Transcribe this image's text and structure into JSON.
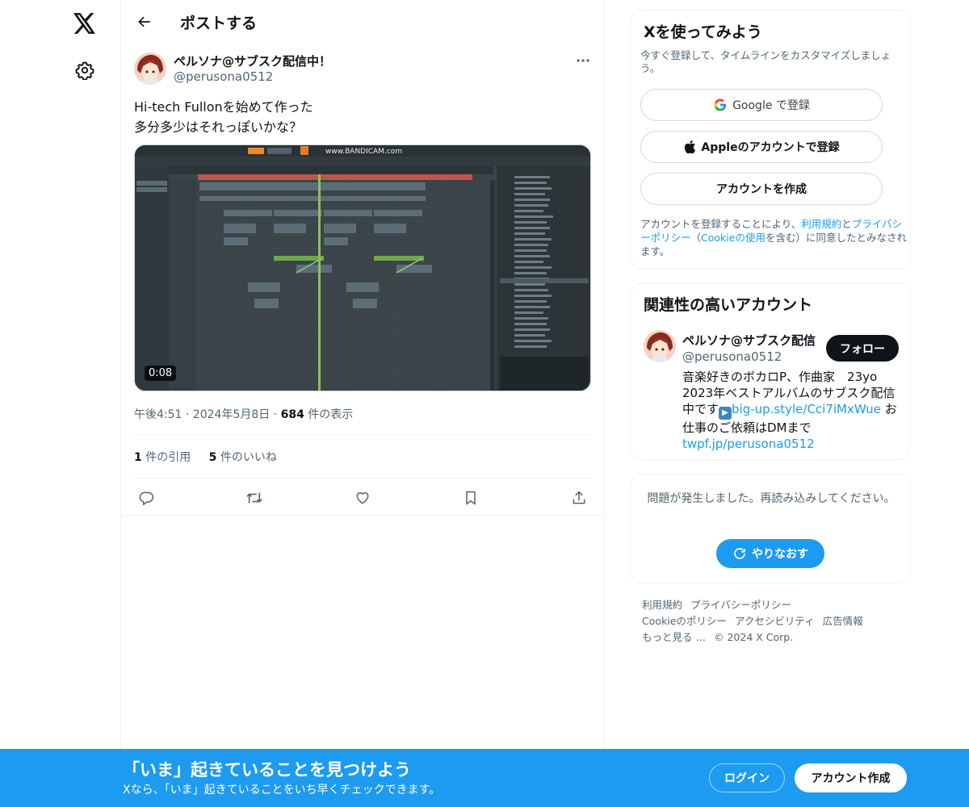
{
  "nav": {
    "logo_icon": "x-logo-icon",
    "settings_icon": "gear-icon"
  },
  "header": {
    "title": "ポストする",
    "back_icon": "arrow-left-icon"
  },
  "tweet": {
    "author_name": "ペルソナ@サブスク配信中！",
    "author_handle": "@perusona0512",
    "text_line1": "Hi-tech Fullonを始めて作った",
    "text_line2": "多分多少はそれっぽいかな？",
    "video_duration": "0:08",
    "video_watermark": "www.BANDICAM.com",
    "time": "午後4:51",
    "date": "2024年5月8日",
    "views_count": "684",
    "views_label": "件の表示",
    "quotes_count": "1",
    "quotes_label": "件の引用",
    "likes_count": "5",
    "likes_label": "件のいいね",
    "action_icons": [
      "reply-icon",
      "retweet-icon",
      "like-icon",
      "bookmark-icon",
      "share-icon"
    ]
  },
  "signup": {
    "title": "Xを使ってみよう",
    "subtitle": "今すぐ登録して、タイムラインをカスタマイズしましょう。",
    "google_label": "Google で登録",
    "apple_label": "Appleのアカウントで登録",
    "create_label": "アカウントを作成",
    "legal_prefix": "アカウントを登録することにより、",
    "legal_terms": "利用規約",
    "legal_and": "と",
    "legal_privacy": "プライバシーポリシー",
    "legal_paren_open": "（",
    "legal_cookie": "Cookieの使用",
    "legal_suffix": "を含む）に同意したとみなされます。"
  },
  "related": {
    "title": "関連性の高いアカウント",
    "name": "ペルソナ@サブスク配信",
    "handle": "@perusona0512",
    "follow_label": "フォロー",
    "bio_line1": "音楽好きのボカロP、作曲家　23yo",
    "bio_line2": "2023年ベストアルバムのサブスク配信",
    "bio_line3_prefix": "中です",
    "bio_link1": "big-up.style/Cci7iMxWue",
    "bio_line3_suffix": " お",
    "bio_line4": "仕事のご依頼はDMまで",
    "bio_link2": "twpf.jp/perusona0512"
  },
  "error_card": {
    "message": "問題が発生しました。再読み込みしてください。",
    "retry_label": "やりなおす"
  },
  "footer": {
    "links": [
      "利用規約",
      "プライバシーポリシー",
      "Cookieのポリシー",
      "アクセシビリティ",
      "広告情報",
      "もっと見る …",
      "© 2024 X Corp."
    ]
  },
  "banner": {
    "title": "「いま」起きていることを見つけよう",
    "subtitle": "Xなら、「いま」起きていることをいち早くチェックできます。",
    "login_label": "ログイン",
    "signup_label": "アカウント作成"
  },
  "colors": {
    "accent": "#1d9bf0",
    "text": "#0f1419",
    "muted": "#536471",
    "border": "#eff3f4"
  }
}
